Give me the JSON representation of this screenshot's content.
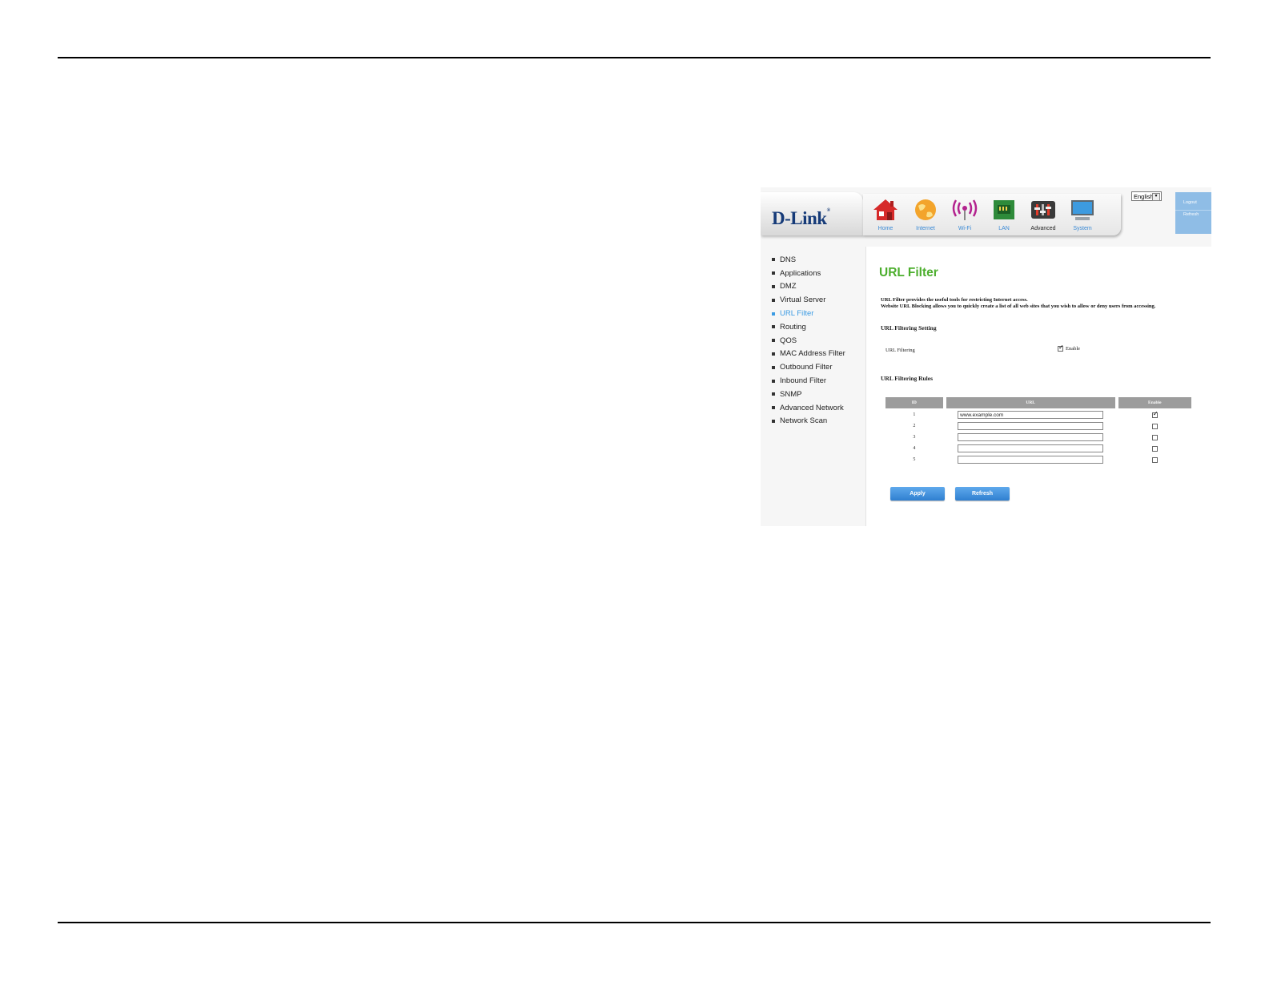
{
  "header": {
    "logo": "D-Link",
    "nav": [
      {
        "label": "Home",
        "icon": "home-icon"
      },
      {
        "label": "Internet",
        "icon": "globe-icon"
      },
      {
        "label": "Wi-Fi",
        "icon": "wifi-icon"
      },
      {
        "label": "LAN",
        "icon": "lan-icon"
      },
      {
        "label": "Advanced",
        "icon": "advanced-icon",
        "active": true
      },
      {
        "label": "System",
        "icon": "monitor-icon"
      }
    ],
    "language": "English",
    "logout": "Logout",
    "refresh": "Refresh"
  },
  "sidebar": {
    "items": [
      {
        "label": "DNS"
      },
      {
        "label": "Applications"
      },
      {
        "label": "DMZ"
      },
      {
        "label": "Virtual Server"
      },
      {
        "label": "URL Filter",
        "active": true
      },
      {
        "label": "Routing"
      },
      {
        "label": "QOS"
      },
      {
        "label": "MAC Address Filter"
      },
      {
        "label": "Outbound Filter"
      },
      {
        "label": "Inbound Filter"
      },
      {
        "label": "SNMP"
      },
      {
        "label": "Advanced Network"
      },
      {
        "label": "Network Scan"
      }
    ]
  },
  "main": {
    "title": "URL Filter",
    "description_line1": "URL Filter provides the useful tools for restricting Internet access.",
    "description_line2": "Website URL Blocking allows you to quickly create a list of all web sites that you wish to allow or deny users from accessing.",
    "setting_title": "URL Filtering Setting",
    "filter_label": "URL Filtering",
    "filter_enable_label": "Enable",
    "filter_enabled": true,
    "rules_title": "URL Filtering Rules",
    "table": {
      "headers": [
        "ID",
        "URL",
        "Enable"
      ],
      "rows": [
        {
          "id": "1",
          "url": "www.example.com",
          "enabled": true
        },
        {
          "id": "2",
          "url": "",
          "enabled": false
        },
        {
          "id": "3",
          "url": "",
          "enabled": false
        },
        {
          "id": "4",
          "url": "",
          "enabled": false
        },
        {
          "id": "5",
          "url": "",
          "enabled": false
        }
      ]
    },
    "apply_label": "Apply",
    "refresh_label": "Refresh"
  },
  "colors": {
    "title_green": "#4cae2d",
    "accent_blue": "#3b9be3",
    "header_gray": "#9c9c9c"
  }
}
